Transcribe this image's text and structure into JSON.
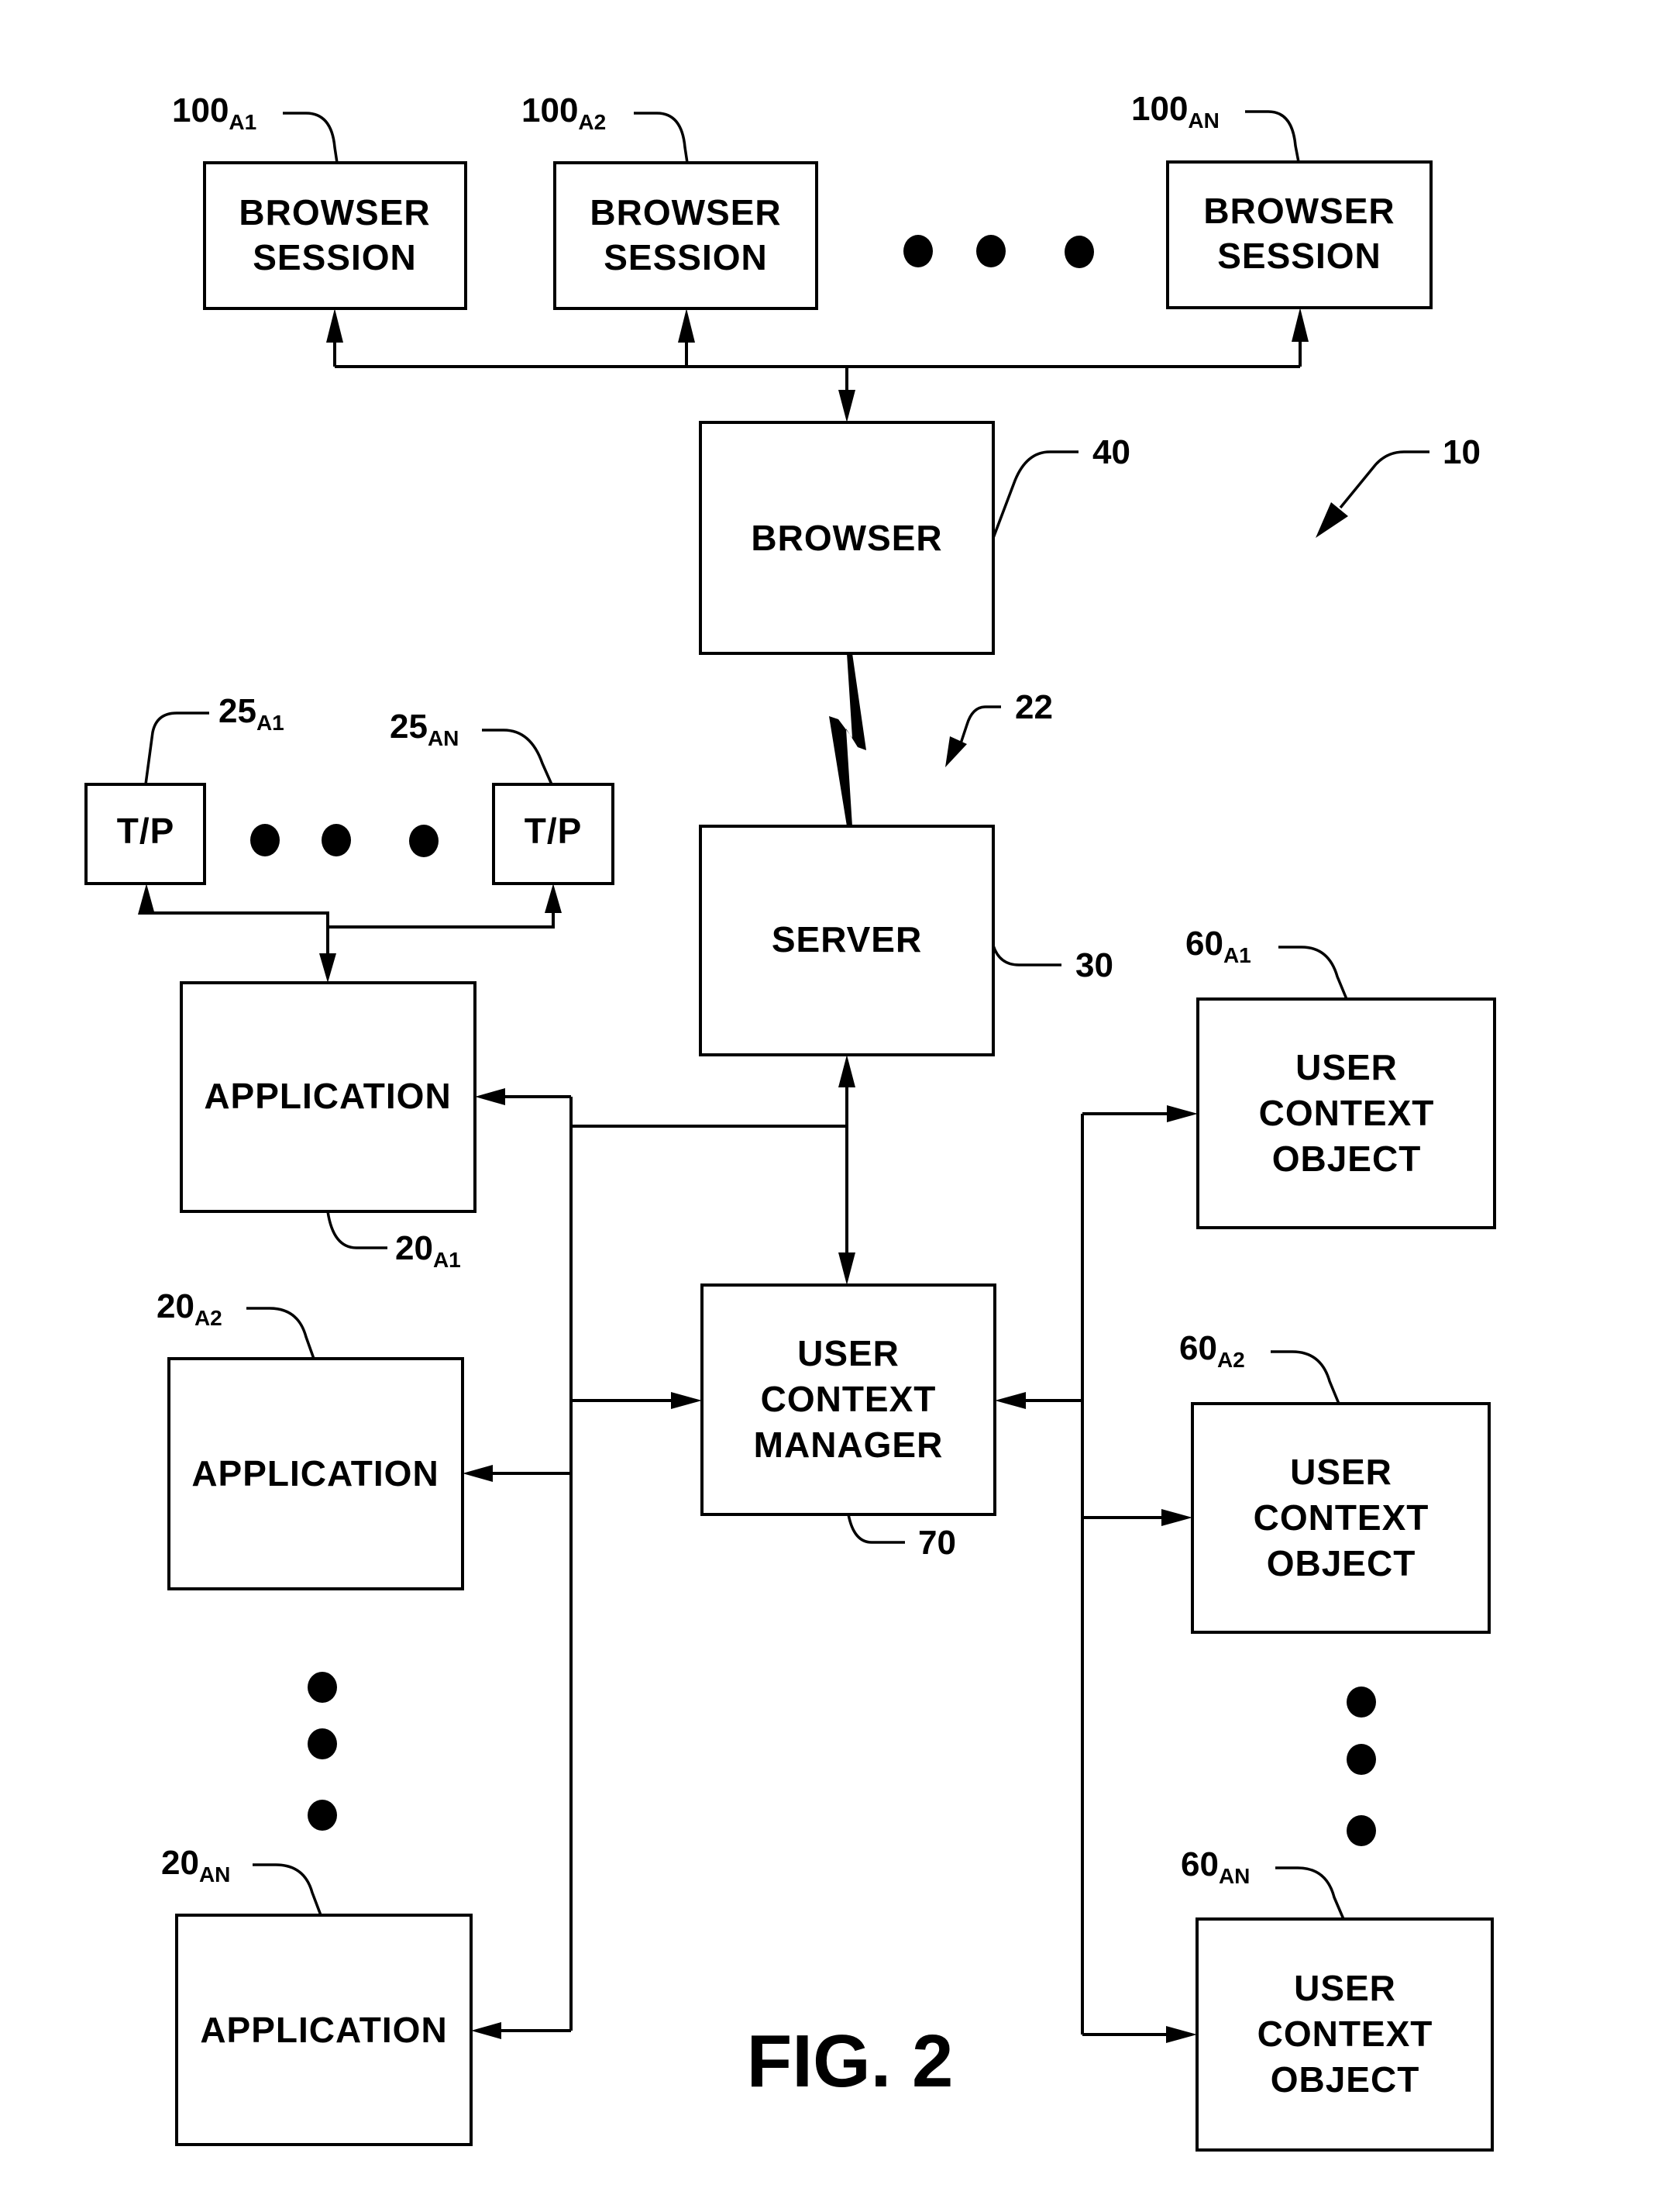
{
  "figure": {
    "title": "FIG. 2",
    "system_ref": "10",
    "link_ref": "22"
  },
  "browser_sessions": [
    {
      "label_lines": [
        "BROWSER",
        "SESSION"
      ],
      "ref": "100",
      "ref_sub": "A1"
    },
    {
      "label_lines": [
        "BROWSER",
        "SESSION"
      ],
      "ref": "100",
      "ref_sub": "A2"
    },
    {
      "label_lines": [
        "BROWSER",
        "SESSION"
      ],
      "ref": "100",
      "ref_sub": "AN"
    }
  ],
  "browser": {
    "label": "BROWSER",
    "ref": "40"
  },
  "server": {
    "label": "SERVER",
    "ref": "30"
  },
  "user_context_manager": {
    "label_lines": [
      "USER",
      "CONTEXT",
      "MANAGER"
    ],
    "ref": "70"
  },
  "tps": [
    {
      "label": "T/P",
      "ref": "25",
      "ref_sub": "A1"
    },
    {
      "label": "T/P",
      "ref": "25",
      "ref_sub": "AN"
    }
  ],
  "applications": [
    {
      "label": "APPLICATION",
      "ref": "20",
      "ref_sub": "A1"
    },
    {
      "label": "APPLICATION",
      "ref": "20",
      "ref_sub": "A2"
    },
    {
      "label": "APPLICATION",
      "ref": "20",
      "ref_sub": "AN"
    }
  ],
  "user_context_objects": [
    {
      "label_lines": [
        "USER",
        "CONTEXT",
        "OBJECT"
      ],
      "ref": "60",
      "ref_sub": "A1"
    },
    {
      "label_lines": [
        "USER",
        "CONTEXT",
        "OBJECT"
      ],
      "ref": "60",
      "ref_sub": "A2"
    },
    {
      "label_lines": [
        "USER",
        "CONTEXT",
        "OBJECT"
      ],
      "ref": "60",
      "ref_sub": "AN"
    }
  ]
}
